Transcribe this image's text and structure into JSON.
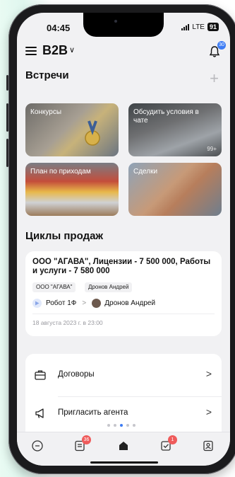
{
  "status": {
    "time": "04:45",
    "network": "LTE",
    "battery": "91"
  },
  "header": {
    "title": "B2B",
    "notifications_count": "30"
  },
  "meetings": {
    "title": "Встречи",
    "tiles": [
      {
        "label": "Конкурсы",
        "count": ""
      },
      {
        "label": "Обсудить условия в чате",
        "count": "99+"
      },
      {
        "label": "План по приходам",
        "count": ""
      },
      {
        "label": "Сделки",
        "count": ""
      }
    ]
  },
  "sales_cycles": {
    "title": "Циклы продаж",
    "card": {
      "title": "ООО \"АГАВА\", Лицензии - 7 500 000, Работы и услуги - 7 580 000",
      "tags": [
        "ООО \"АГАВА\"",
        "Дронов Андрей"
      ],
      "from": "Робот 1Ф",
      "to": "Дронов Андрей",
      "date": "18 августа 2023 г. в 23:00"
    }
  },
  "menu": {
    "items": [
      {
        "label": "Договоры",
        "icon": "briefcase-icon"
      },
      {
        "label": "Пригласить агента",
        "icon": "megaphone-icon"
      }
    ]
  },
  "tabbar": {
    "items": [
      {
        "icon": "chat-icon",
        "badge": ""
      },
      {
        "icon": "news-icon",
        "badge": "36"
      },
      {
        "icon": "home-icon",
        "badge": ""
      },
      {
        "icon": "tasks-icon",
        "badge": "1"
      },
      {
        "icon": "contacts-icon",
        "badge": ""
      }
    ]
  },
  "colors": {
    "accent": "#3d7cf4",
    "badge_red": "#ef5b5b",
    "screen_bg": "#f1f1f3"
  }
}
